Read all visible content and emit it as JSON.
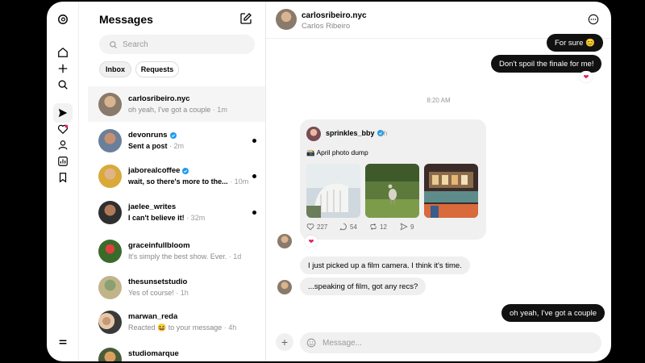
{
  "rail": {
    "icons": [
      "threads-logo-icon",
      "home-icon",
      "plus-icon",
      "search-icon",
      "send-icon",
      "heart-icon",
      "profile-icon",
      "insights-icon",
      "bookmark-icon",
      "menu-icon"
    ]
  },
  "list": {
    "title": "Messages",
    "search_placeholder": "Search",
    "tabs": [
      "Inbox",
      "Requests"
    ],
    "conversations": [
      {
        "name": "carlosribeiro.nyc",
        "preview": "oh yeah, I've got a couple",
        "time": "· 1m",
        "verified": false,
        "unread": false,
        "selected": true
      },
      {
        "name": "devonruns",
        "preview": "Sent a post",
        "time": "· 2m",
        "verified": true,
        "unread": true
      },
      {
        "name": "jaborealcoffee",
        "preview": "wait, so there's more to the...",
        "time": "· 10m",
        "verified": true,
        "unread": true
      },
      {
        "name": "jaelee_writes",
        "preview": "I can't believe it!",
        "time": "· 32m",
        "verified": false,
        "unread": true
      },
      {
        "name": "graceinfullbloom",
        "preview": "It's simply the best show. Ever.",
        "time": "· 1d",
        "verified": false,
        "unread": false
      },
      {
        "name": "thesunsetstudio",
        "preview": "Yes of course!",
        "time": "· 1h",
        "verified": false,
        "unread": false
      },
      {
        "name": "marwan_reda",
        "preview": "Reacted 😆 to your message",
        "time": "· 4h",
        "verified": false,
        "unread": false
      },
      {
        "name": "studiomarque",
        "preview": "",
        "time": "",
        "verified": false,
        "unread": false
      }
    ]
  },
  "chat": {
    "username": "carlosribeiro.nyc",
    "fullname": "Carlos Ribeiro",
    "messages": {
      "m1": "For sure 😊",
      "m2": "Don't spoil the finale for me!",
      "timestamp": "8:20 AM",
      "m3": "I just picked up a film camera. I think it's time.",
      "m4": "...speaking of film, got any recs?",
      "m5": "oh yeah, I've got a couple"
    },
    "reaction": "❤",
    "shared_post": {
      "author": "sprinkles_bby",
      "time": "1h",
      "text": "📸 April photo dump",
      "likes": "227",
      "comments": "54",
      "reposts": "12",
      "shares": "9"
    },
    "input_placeholder": "Message..."
  }
}
